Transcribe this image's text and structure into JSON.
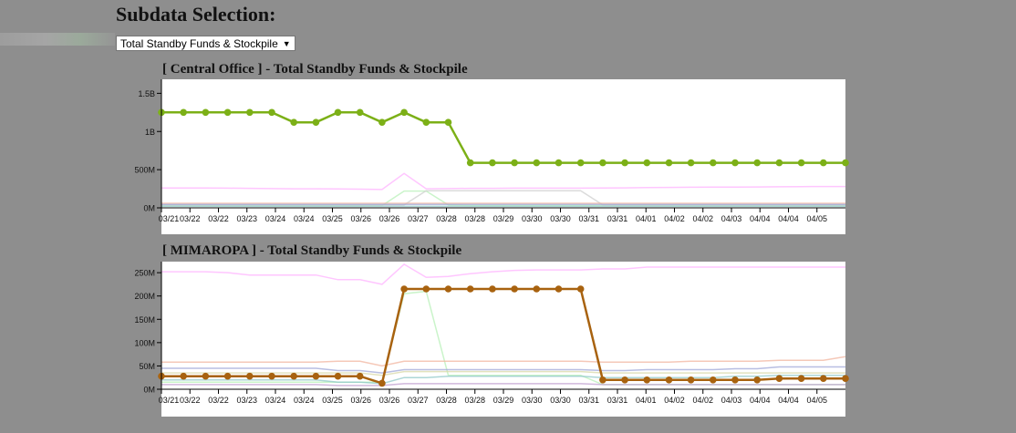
{
  "heading": "Subdata Selection:",
  "select": {
    "value": "Total Standby Funds & Stockpile"
  },
  "colors": {
    "page_background": "#8e8e8e",
    "central_office_line": "#7cb017",
    "mimaropa_line": "#a8620f"
  },
  "chart_data": [
    {
      "type": "line",
      "title": "[ Central Office ] - Total Standby Funds & Stockpile",
      "categories": [
        "03/21",
        "03/21",
        "03/22",
        "03/22",
        "03/23",
        "03/23",
        "03/24",
        "03/24",
        "03/25",
        "03/25",
        "03/26",
        "03/26",
        "03/27",
        "03/27",
        "03/28",
        "03/28",
        "03/29",
        "03/29",
        "03/30",
        "03/30",
        "03/31",
        "03/31",
        "04/01",
        "04/01",
        "04/02",
        "04/02",
        "04/03",
        "04/03",
        "04/04",
        "04/04",
        "04/05",
        "04/05"
      ],
      "tick_labels": [
        "03/21",
        "03/22",
        "03/22",
        "03/23",
        "03/24",
        "03/24",
        "03/25",
        "03/26",
        "03/26",
        "03/27",
        "03/28",
        "03/28",
        "03/29",
        "03/30",
        "03/30",
        "03/31",
        "03/31",
        "04/01",
        "04/02",
        "04/02",
        "04/03",
        "04/04",
        "04/04",
        "04/05"
      ],
      "y_tick_labels": [
        "0M",
        "500M",
        "1B",
        "1.5B"
      ],
      "ylim": [
        0,
        1600000000
      ],
      "grid": false,
      "series": [
        {
          "color": "#7cb017",
          "highlight": true,
          "values": [
            1250000000,
            1250000000,
            1250000000,
            1250000000,
            1250000000,
            1250000000,
            1120000000,
            1120000000,
            1250000000,
            1250000000,
            1120000000,
            1250000000,
            1120000000,
            1120000000,
            590000000,
            590000000,
            590000000,
            590000000,
            590000000,
            590000000,
            590000000,
            590000000,
            590000000,
            590000000,
            590000000,
            590000000,
            590000000,
            590000000,
            590000000,
            590000000,
            590000000,
            590000000
          ]
        },
        {
          "color": "#ffb3ff",
          "values": [
            260000000,
            260000000,
            260000000,
            258000000,
            255000000,
            252000000,
            250000000,
            250000000,
            248000000,
            245000000,
            240000000,
            450000000,
            250000000,
            252000000,
            255000000,
            256000000,
            258000000,
            258000000,
            258000000,
            258000000,
            260000000,
            262000000,
            265000000,
            268000000,
            270000000,
            272000000,
            272000000,
            274000000,
            276000000,
            278000000,
            280000000,
            280000000
          ]
        },
        {
          "color": "#b8f0b8",
          "values": [
            30000000,
            30000000,
            30000000,
            30000000,
            30000000,
            30000000,
            30000000,
            30000000,
            30000000,
            30000000,
            30000000,
            220000000,
            220000000,
            40000000,
            30000000,
            30000000,
            30000000,
            30000000,
            30000000,
            30000000,
            30000000,
            30000000,
            30000000,
            30000000,
            30000000,
            30000000,
            30000000,
            30000000,
            30000000,
            30000000,
            30000000,
            30000000
          ]
        },
        {
          "color": "#cfcfcf",
          "values": [
            40000000,
            40000000,
            40000000,
            40000000,
            40000000,
            40000000,
            40000000,
            40000000,
            40000000,
            40000000,
            40000000,
            40000000,
            225000000,
            225000000,
            225000000,
            225000000,
            225000000,
            225000000,
            225000000,
            225000000,
            40000000,
            40000000,
            40000000,
            40000000,
            40000000,
            40000000,
            40000000,
            40000000,
            40000000,
            40000000,
            40000000,
            40000000
          ]
        },
        {
          "color": "#f2b6a0",
          "values": [
            60000000,
            60000000,
            60000000,
            60000000,
            60000000,
            60000000,
            60000000,
            60000000,
            60000000,
            60000000,
            60000000,
            60000000,
            60000000,
            60000000,
            60000000,
            60000000,
            60000000,
            60000000,
            60000000,
            60000000,
            60000000,
            60000000,
            60000000,
            60000000,
            60000000,
            60000000,
            60000000,
            60000000,
            60000000,
            60000000,
            60000000,
            60000000
          ]
        },
        {
          "color": "#a0a8d8",
          "values": [
            45000000,
            45000000,
            45000000,
            45000000,
            45000000,
            45000000,
            45000000,
            45000000,
            45000000,
            45000000,
            45000000,
            45000000,
            45000000,
            45000000,
            45000000,
            45000000,
            45000000,
            45000000,
            45000000,
            45000000,
            45000000,
            45000000,
            45000000,
            45000000,
            45000000,
            45000000,
            45000000,
            45000000,
            45000000,
            45000000,
            45000000,
            45000000
          ]
        },
        {
          "color": "#90c8c8",
          "values": [
            20000000,
            20000000,
            20000000,
            20000000,
            20000000,
            20000000,
            20000000,
            20000000,
            20000000,
            20000000,
            20000000,
            20000000,
            20000000,
            20000000,
            20000000,
            20000000,
            20000000,
            20000000,
            20000000,
            20000000,
            20000000,
            20000000,
            20000000,
            20000000,
            20000000,
            20000000,
            20000000,
            20000000,
            20000000,
            20000000,
            20000000,
            20000000
          ]
        }
      ]
    },
    {
      "type": "line",
      "title": "[ MIMAROPA ] - Total Standby Funds & Stockpile",
      "categories": [
        "03/21",
        "03/21",
        "03/22",
        "03/22",
        "03/23",
        "03/23",
        "03/24",
        "03/24",
        "03/25",
        "03/25",
        "03/26",
        "03/26",
        "03/27",
        "03/27",
        "03/28",
        "03/28",
        "03/29",
        "03/29",
        "03/30",
        "03/30",
        "03/31",
        "03/31",
        "04/01",
        "04/01",
        "04/02",
        "04/02",
        "04/03",
        "04/03",
        "04/04",
        "04/04",
        "04/05",
        "04/05"
      ],
      "tick_labels": [
        "03/21",
        "03/22",
        "03/22",
        "03/23",
        "03/24",
        "03/24",
        "03/25",
        "03/26",
        "03/26",
        "03/27",
        "03/28",
        "03/28",
        "03/29",
        "03/30",
        "03/30",
        "03/31",
        "03/31",
        "04/01",
        "04/02",
        "04/02",
        "04/03",
        "04/04",
        "04/04",
        "04/05"
      ],
      "y_tick_labels": [
        "0M",
        "50M",
        "100M",
        "150M",
        "200M",
        "250M"
      ],
      "ylim": [
        0,
        262000000
      ],
      "grid": false,
      "series": [
        {
          "color": "#a8620f",
          "highlight": true,
          "values": [
            28000000,
            28000000,
            28000000,
            28000000,
            28000000,
            28000000,
            28000000,
            28000000,
            28000000,
            28000000,
            13000000,
            215000000,
            215000000,
            215000000,
            215000000,
            215000000,
            215000000,
            215000000,
            215000000,
            215000000,
            20000000,
            20000000,
            20000000,
            20000000,
            20000000,
            20000000,
            20000000,
            20000000,
            23000000,
            23000000,
            23000000,
            23000000
          ]
        },
        {
          "color": "#ffb3ff",
          "values": [
            252000000,
            252000000,
            252000000,
            250000000,
            245000000,
            245000000,
            245000000,
            245000000,
            235000000,
            235000000,
            225000000,
            268000000,
            240000000,
            242000000,
            248000000,
            252000000,
            255000000,
            256000000,
            256000000,
            256000000,
            258000000,
            258000000,
            262000000,
            262000000,
            262000000,
            262000000,
            262000000,
            262000000,
            262000000,
            262000000,
            262000000,
            262000000
          ]
        },
        {
          "color": "#b8f0b8",
          "values": [
            15000000,
            15000000,
            15000000,
            15000000,
            15000000,
            15000000,
            15000000,
            15000000,
            15000000,
            15000000,
            15000000,
            205000000,
            210000000,
            30000000,
            30000000,
            30000000,
            30000000,
            30000000,
            30000000,
            30000000,
            10000000,
            10000000,
            10000000,
            10000000,
            10000000,
            10000000,
            10000000,
            10000000,
            10000000,
            10000000,
            10000000,
            10000000
          ]
        },
        {
          "color": "#f2b6a0",
          "values": [
            58000000,
            58000000,
            58000000,
            58000000,
            58000000,
            58000000,
            58000000,
            58000000,
            60000000,
            60000000,
            50000000,
            60000000,
            60000000,
            60000000,
            60000000,
            60000000,
            60000000,
            60000000,
            60000000,
            60000000,
            58000000,
            58000000,
            58000000,
            58000000,
            60000000,
            60000000,
            60000000,
            60000000,
            62000000,
            62000000,
            62000000,
            70000000
          ]
        },
        {
          "color": "#a0a8d8",
          "values": [
            45000000,
            45000000,
            45000000,
            45000000,
            45000000,
            45000000,
            45000000,
            45000000,
            40000000,
            40000000,
            35000000,
            42000000,
            42000000,
            42000000,
            42000000,
            42000000,
            42000000,
            42000000,
            42000000,
            42000000,
            40000000,
            40000000,
            42000000,
            42000000,
            42000000,
            42000000,
            44000000,
            44000000,
            48000000,
            48000000,
            48000000,
            48000000
          ]
        },
        {
          "color": "#d8d8a8",
          "values": [
            35000000,
            35000000,
            35000000,
            35000000,
            35000000,
            35000000,
            35000000,
            35000000,
            35000000,
            35000000,
            30000000,
            38000000,
            38000000,
            38000000,
            38000000,
            38000000,
            38000000,
            38000000,
            38000000,
            38000000,
            35000000,
            35000000,
            35000000,
            35000000,
            35000000,
            35000000,
            35000000,
            35000000,
            35000000,
            35000000,
            35000000,
            35000000
          ]
        },
        {
          "color": "#90c8c8",
          "values": [
            20000000,
            20000000,
            20000000,
            20000000,
            20000000,
            20000000,
            20000000,
            20000000,
            15000000,
            15000000,
            12000000,
            25000000,
            25000000,
            28000000,
            28000000,
            28000000,
            28000000,
            28000000,
            28000000,
            28000000,
            25000000,
            25000000,
            25000000,
            25000000,
            25000000,
            25000000,
            28000000,
            28000000,
            30000000,
            30000000,
            30000000,
            30000000
          ]
        },
        {
          "color": "#c0a0d0",
          "values": [
            10000000,
            10000000,
            10000000,
            10000000,
            10000000,
            10000000,
            10000000,
            10000000,
            8000000,
            8000000,
            8000000,
            12000000,
            12000000,
            12000000,
            12000000,
            12000000,
            12000000,
            12000000,
            12000000,
            12000000,
            10000000,
            10000000,
            10000000,
            10000000,
            10000000,
            10000000,
            10000000,
            10000000,
            10000000,
            10000000,
            10000000,
            10000000
          ]
        }
      ]
    }
  ]
}
